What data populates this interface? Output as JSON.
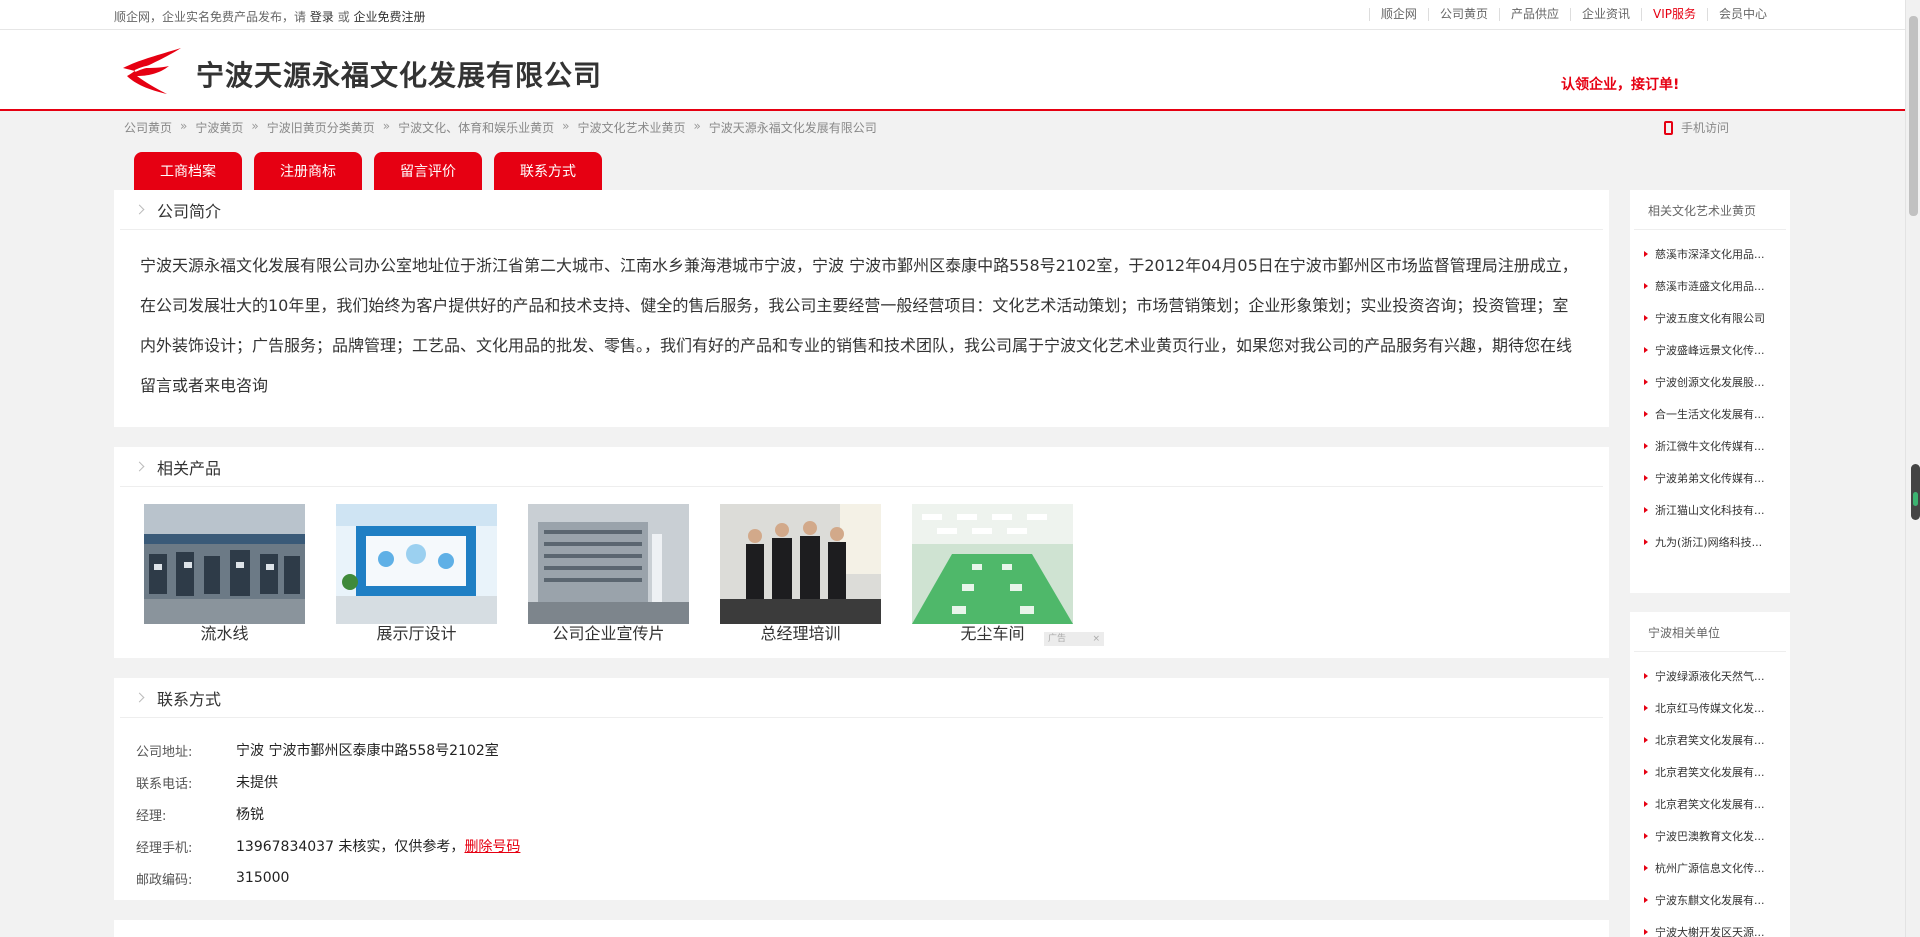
{
  "topbar": {
    "intro": "顺企网，企业实名免费产品发布，请",
    "login": "登录",
    "or": "或",
    "register": "企业免费注册",
    "nav": [
      "顺企网",
      "公司黄页",
      "产品供应",
      "企业资讯",
      "VIP服务",
      "会员中心"
    ]
  },
  "header": {
    "company_name": "宁波天源永福文化发展有限公司",
    "claim": "认领企业，接订单!"
  },
  "breadcrumb": [
    "公司黄页",
    "宁波黄页",
    "宁波旧黄页分类黄页",
    "宁波文化、体育和娱乐业黄页",
    "宁波文化艺术业黄页",
    "宁波天源永福文化发展有限公司"
  ],
  "breadcrumb_sep": "»",
  "mobile_label": "手机访问",
  "tabs": [
    "工商档案",
    "注册商标",
    "留言评价",
    "联系方式"
  ],
  "intro": {
    "title": "公司简介",
    "text": "宁波天源永福文化发展有限公司办公室地址位于浙江省第二大城市、江南水乡兼海港城市宁波，宁波 宁波市鄞州区泰康中路558号2102室，于2012年04月05日在宁波市鄞州区市场监督管理局注册成立，在公司发展壮大的10年里，我们始终为客户提供好的产品和技术支持、健全的售后服务，我公司主要经营一般经营项目：文化艺术活动策划；市场营销策划；企业形象策划；实业投资咨询；投资管理；室内外装饰设计；广告服务；品牌管理；工艺品、文化用品的批发、零售。，我们有好的产品和专业的销售和技术团队，我公司属于宁波文化艺术业黄页行业，如果您对我公司的产品服务有兴趣，期待您在线留言或者来电咨询"
  },
  "products": {
    "title": "相关产品",
    "items": [
      {
        "name": "流水线",
        "icon": "assembly-line-photo"
      },
      {
        "name": "展示厅设计",
        "icon": "showroom-photo"
      },
      {
        "name": "公司企业宣传片",
        "icon": "office-building-photo"
      },
      {
        "name": "总经理培训",
        "icon": "team-photo"
      },
      {
        "name": "无尘车间",
        "icon": "cleanroom-photo"
      }
    ],
    "ad_label": "广告"
  },
  "contact": {
    "title": "联系方式",
    "rows": [
      {
        "key": "公司地址:",
        "value": "宁波 宁波市鄞州区泰康中路558号2102室"
      },
      {
        "key": "联系电话:",
        "value": "未提供"
      },
      {
        "key": "经理:",
        "value": "杨锐"
      },
      {
        "key": "经理手机:",
        "value": "13967834037 未核实，仅供参考，",
        "link": "删除号码"
      },
      {
        "key": "邮政编码:",
        "value": "315000"
      }
    ]
  },
  "sidebar": {
    "related": {
      "title": "相关文化艺术业黄页",
      "items": [
        "慈溪市深泽文化用品...",
        "慈溪市涟盛文化用品...",
        "宁波五度文化有限公司",
        "宁波盛峰远景文化传...",
        "宁波创源文化发展股...",
        "合一生活文化发展有...",
        "浙江微牛文化传媒有...",
        "宁波弟弟文化传媒有...",
        "浙江猫山文化科技有...",
        "九为(浙江)网络科技..."
      ]
    },
    "local": {
      "title": "宁波相关单位",
      "items": [
        "宁波绿源液化天然气...",
        "北京红马传媒文化发...",
        "北京君笑文化发展有...",
        "北京君笑文化发展有...",
        "北京君笑文化发展有...",
        "宁波巴澳教育文化发...",
        "杭州广源信息文化传...",
        "宁波东麒文化发展有...",
        "宁波大榭开发区天源..."
      ]
    }
  },
  "colors": {
    "brand_red": "#e60012",
    "background": "#f2f2f2"
  }
}
